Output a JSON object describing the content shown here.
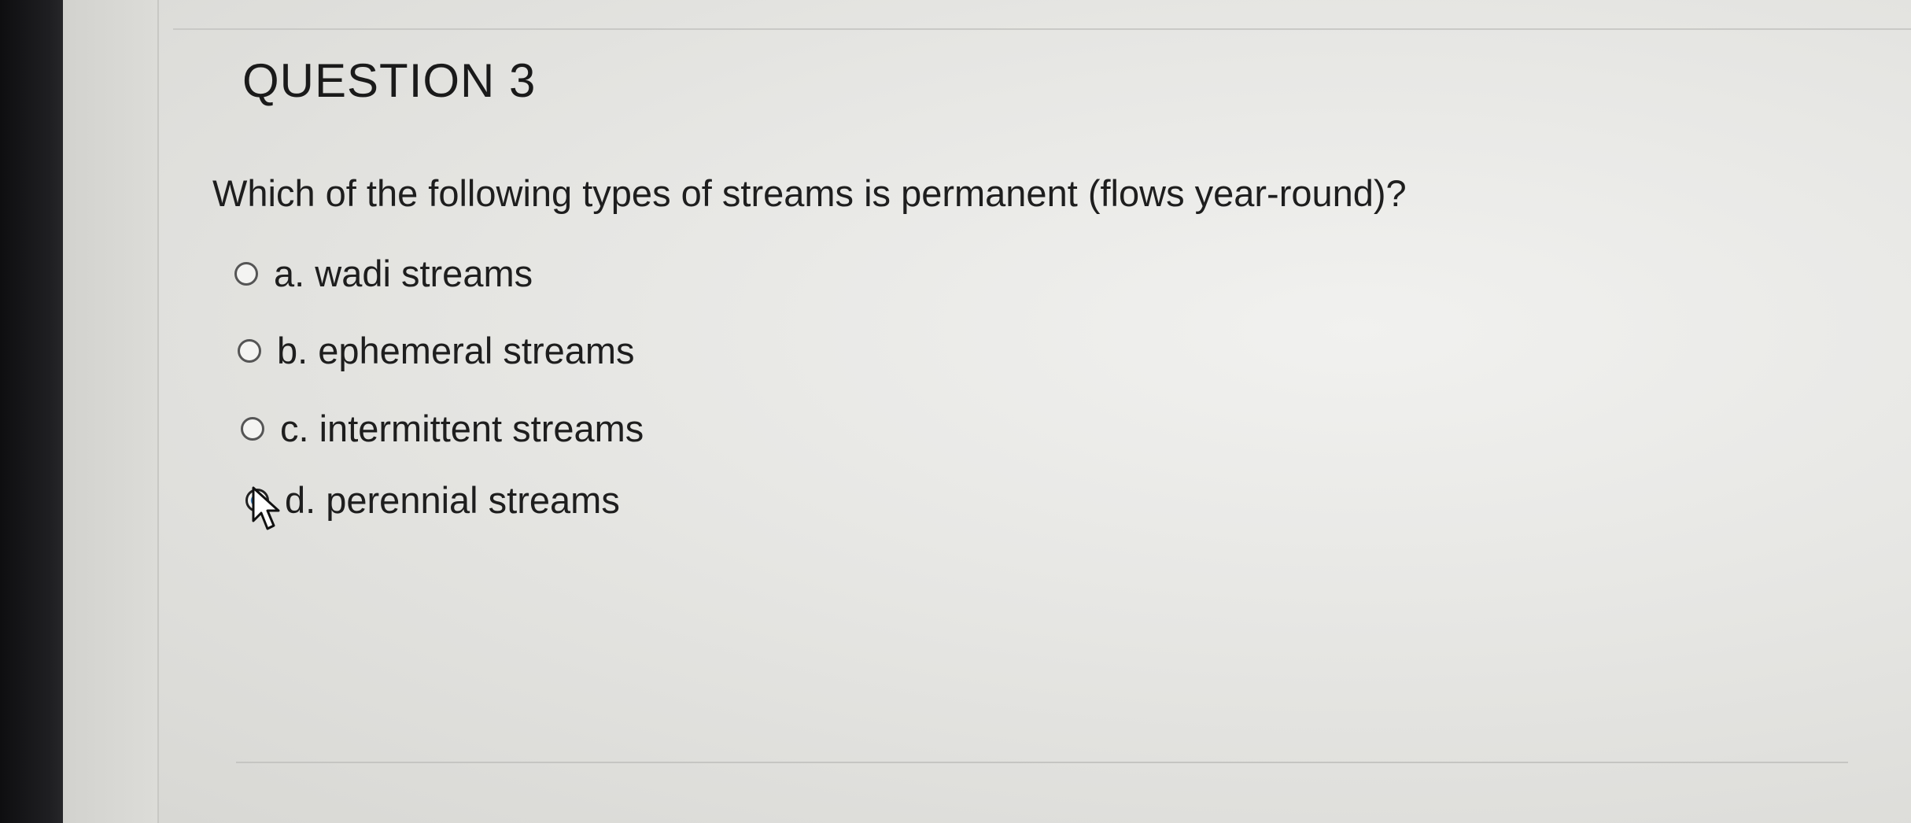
{
  "question": {
    "title": "QUESTION 3",
    "text": "Which of the following types of streams is permanent (flows year-round)?"
  },
  "options": [
    {
      "label": "a. wadi streams",
      "selected": false
    },
    {
      "label": "b. ephemeral streams",
      "selected": false
    },
    {
      "label": "c. intermittent streams",
      "selected": false
    },
    {
      "label": "d. perennial streams",
      "selected": true
    }
  ],
  "colors": {
    "selected_radio": "#2a6fb0",
    "text": "#1e1e1e",
    "background": "#e6e6e3"
  },
  "icons": {
    "cursor": "mouse-pointer-icon"
  }
}
